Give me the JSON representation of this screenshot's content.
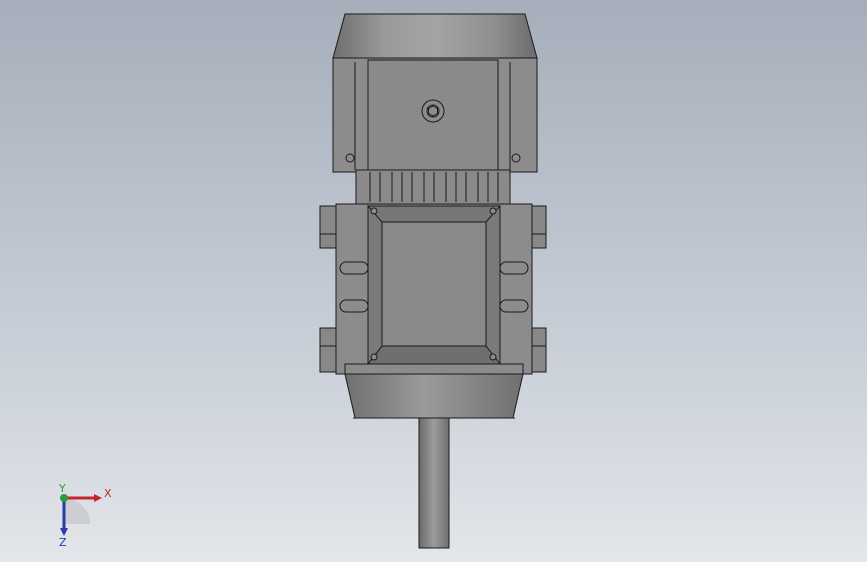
{
  "viewport": {
    "background_top": "#a6aebb",
    "background_bottom": "#e3e6ea"
  },
  "model": {
    "body_color": "#8c8c8c",
    "face_color": "#8a8a8a",
    "shadow_color": "#777777",
    "edge_color": "#1a1a1a"
  },
  "triad": {
    "x_label": "X",
    "y_label": "Y",
    "z_label": "Z",
    "x_color": "#c0282a",
    "y_color": "#2f9a3a",
    "z_color": "#2a3aa8"
  }
}
